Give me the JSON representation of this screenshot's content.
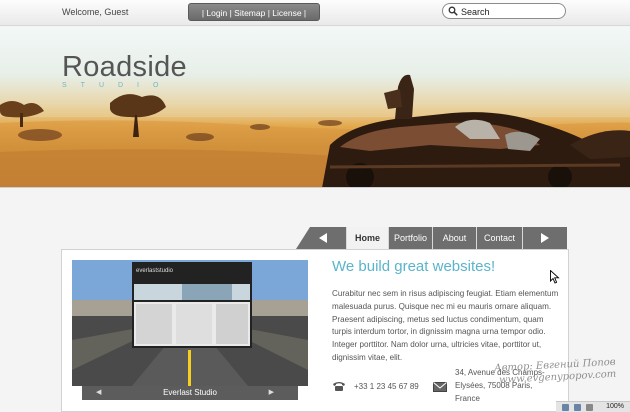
{
  "topbar": {
    "welcome": "Welcome, Guest",
    "links": "| Login | Sitemap | License |",
    "search_placeholder": "Search"
  },
  "banner": {
    "brand": "Roadside",
    "brand_sub": "STUDIO"
  },
  "nav": {
    "items": [
      "Home",
      "Portfolio",
      "About",
      "Contact"
    ],
    "active": "Home"
  },
  "content": {
    "thumb_caption": "Everlast Studio",
    "thumb_site_title": "everlaststudio",
    "headline": "We build great websites!",
    "body": "Curabitur nec sem in risus adipiscing feugiat. Etiam elementum malesuada purus. Quisque nec mi eu mauris ornare aliquam. Praesent adipiscing, metus sed luctus condimentum, quam turpis interdum tortor, in dignissim magna urna tempor odio. Integer porttitor. Nam dolor urna, ultricies vitae, porttitor ut, dignissim vitae, elit.",
    "phone": "+33 1 23 45 67 89",
    "address": "34, Avenue des Champs-Elysées, 75008 Paris, France"
  },
  "watermark": {
    "line1": "Автор: Евгений Попов",
    "line2": "www.evgenypopov.com"
  },
  "statusbar": {
    "zoom": "100%"
  },
  "colors": {
    "accent": "#5ab4cc",
    "nav_bg": "#6e6e6e",
    "nav_active_bg": "#f2f2f2"
  }
}
